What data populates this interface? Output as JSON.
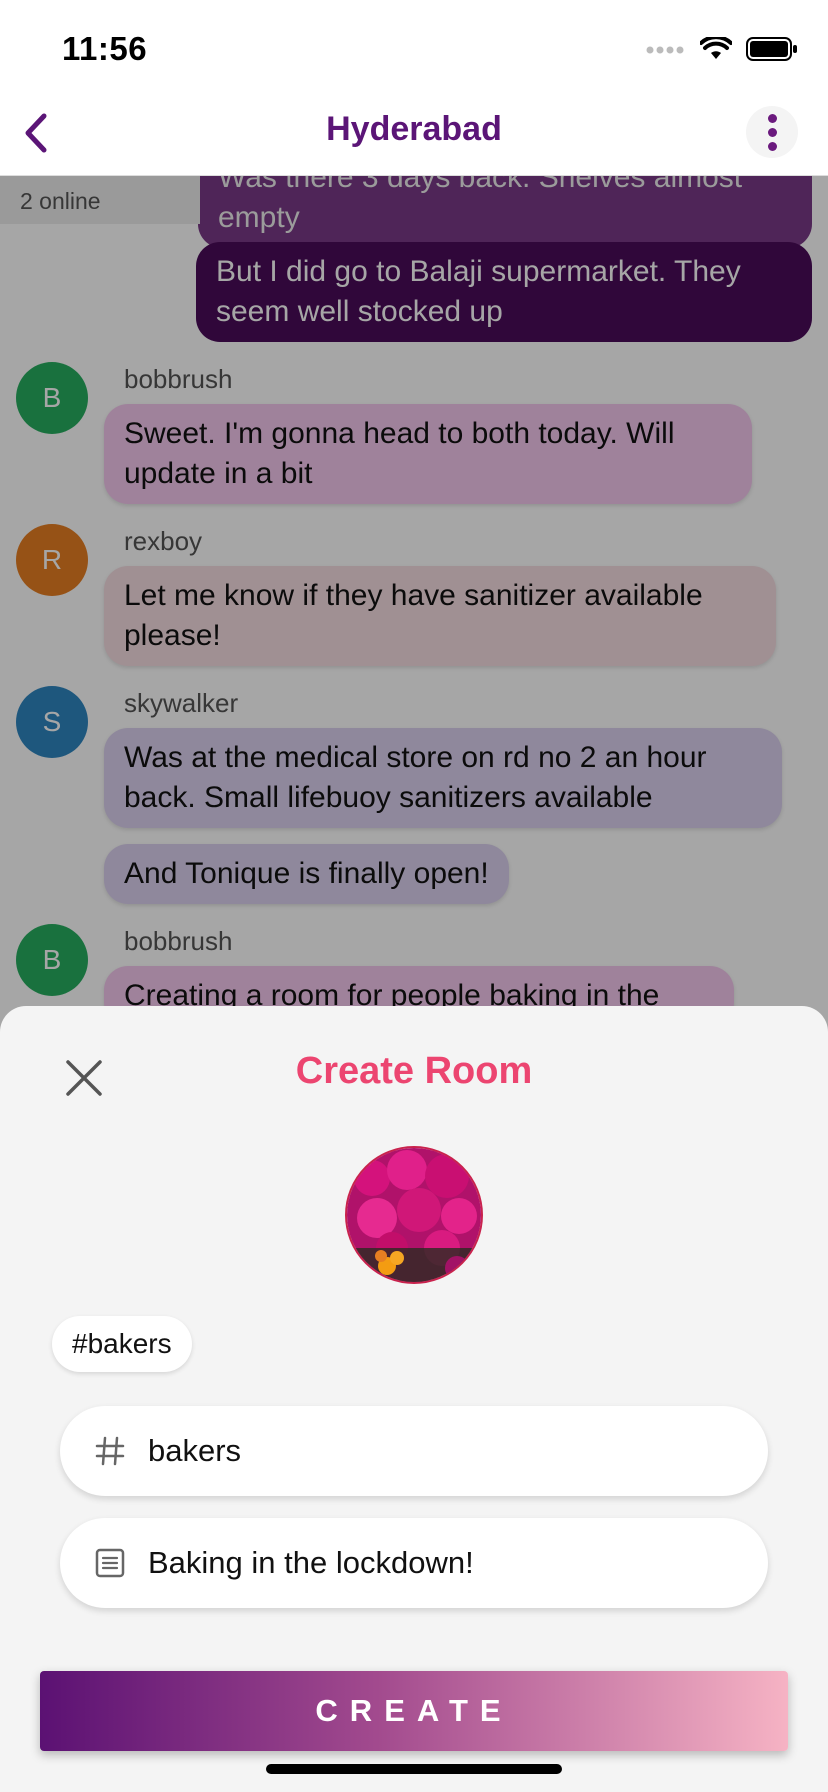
{
  "status_bar": {
    "time": "11:56"
  },
  "nav": {
    "title": "Hyderabad"
  },
  "chat": {
    "online": "2 online",
    "messages": [
      {
        "text": "Was there 3 days back. Shelves almost empty"
      },
      {
        "text": "But I did go to Balaji supermarket. They seem well stocked up"
      },
      {
        "user": "bobbrush",
        "initial": "B",
        "text": "Sweet. I'm gonna head to both today. Will update in a bit"
      },
      {
        "user": "rexboy",
        "initial": "R",
        "text": "Let me know if they have sanitizer available please!"
      },
      {
        "user": "skywalker",
        "initial": "S",
        "text": "Was at the medical store on rd no 2 an hour back. Small lifebuoy sanitizers available"
      },
      {
        "text": "And Tonique is finally open!"
      },
      {
        "user": "bobbrush",
        "initial": "B",
        "text": "Creating a room for people baking in the"
      }
    ]
  },
  "create_room": {
    "title": "Create Room",
    "chip": "#bakers",
    "name_field": {
      "value": "bakers"
    },
    "description_field": {
      "value": "Baking in the lockdown!"
    },
    "create_label": "CREATE"
  },
  "colors": {
    "brand_purple": "#5b1577",
    "title_pink": "#ec4570",
    "avatar_green": "#27ae60",
    "avatar_orange": "#e67e22",
    "avatar_blue": "#2e86c1"
  }
}
